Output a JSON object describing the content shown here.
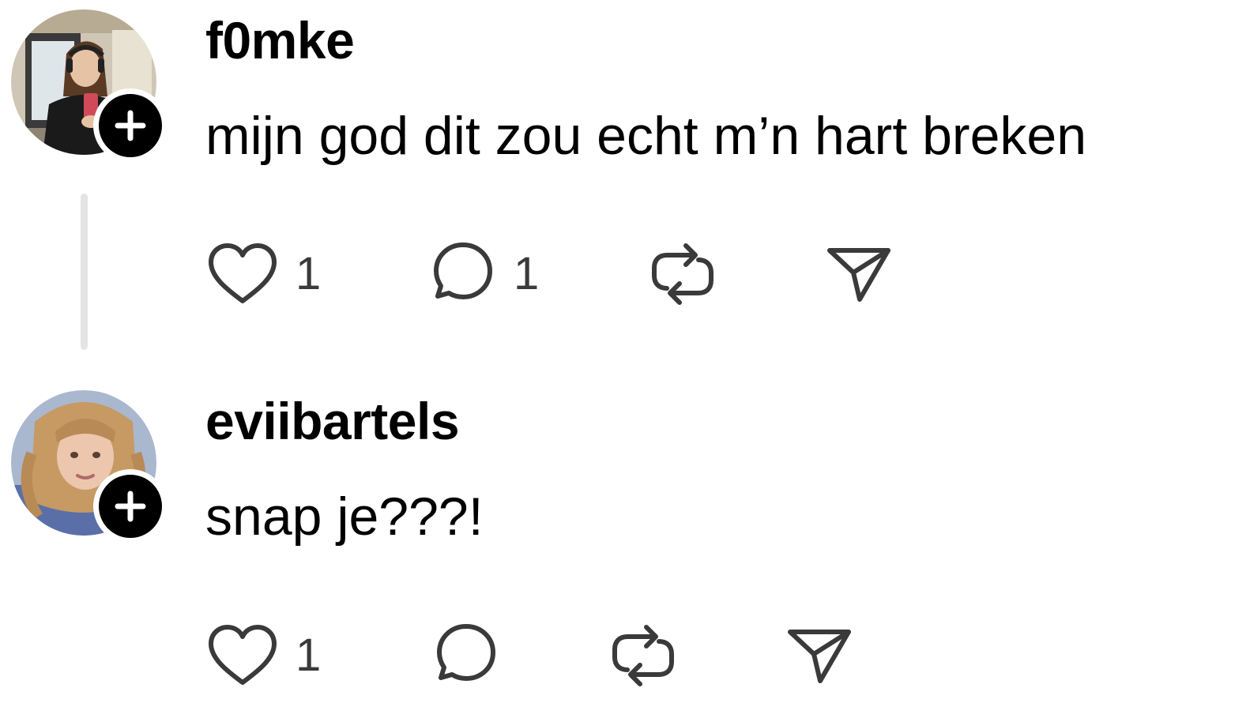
{
  "theme": {
    "text_color": "#000000",
    "icon_color": "#3a3a3a",
    "thread_line_color": "#e4e4e4",
    "badge_color": "#000000"
  },
  "posts": [
    {
      "username": "f0mke",
      "text": "mijn god dit zou echt m’n hart breken",
      "avatar_icon": "profile-photo",
      "follow_icon": "plus-icon",
      "actions": {
        "like": {
          "icon": "heart-icon",
          "count": "1"
        },
        "reply": {
          "icon": "comment-icon",
          "count": "1"
        },
        "repost": {
          "icon": "repost-icon"
        },
        "share": {
          "icon": "send-icon"
        }
      }
    },
    {
      "username": "eviibartels",
      "text": "snap je???!",
      "avatar_icon": "profile-photo",
      "follow_icon": "plus-icon",
      "actions": {
        "like": {
          "icon": "heart-icon",
          "count": "1"
        },
        "reply": {
          "icon": "comment-icon"
        },
        "repost": {
          "icon": "repost-icon"
        },
        "share": {
          "icon": "send-icon"
        }
      }
    }
  ]
}
